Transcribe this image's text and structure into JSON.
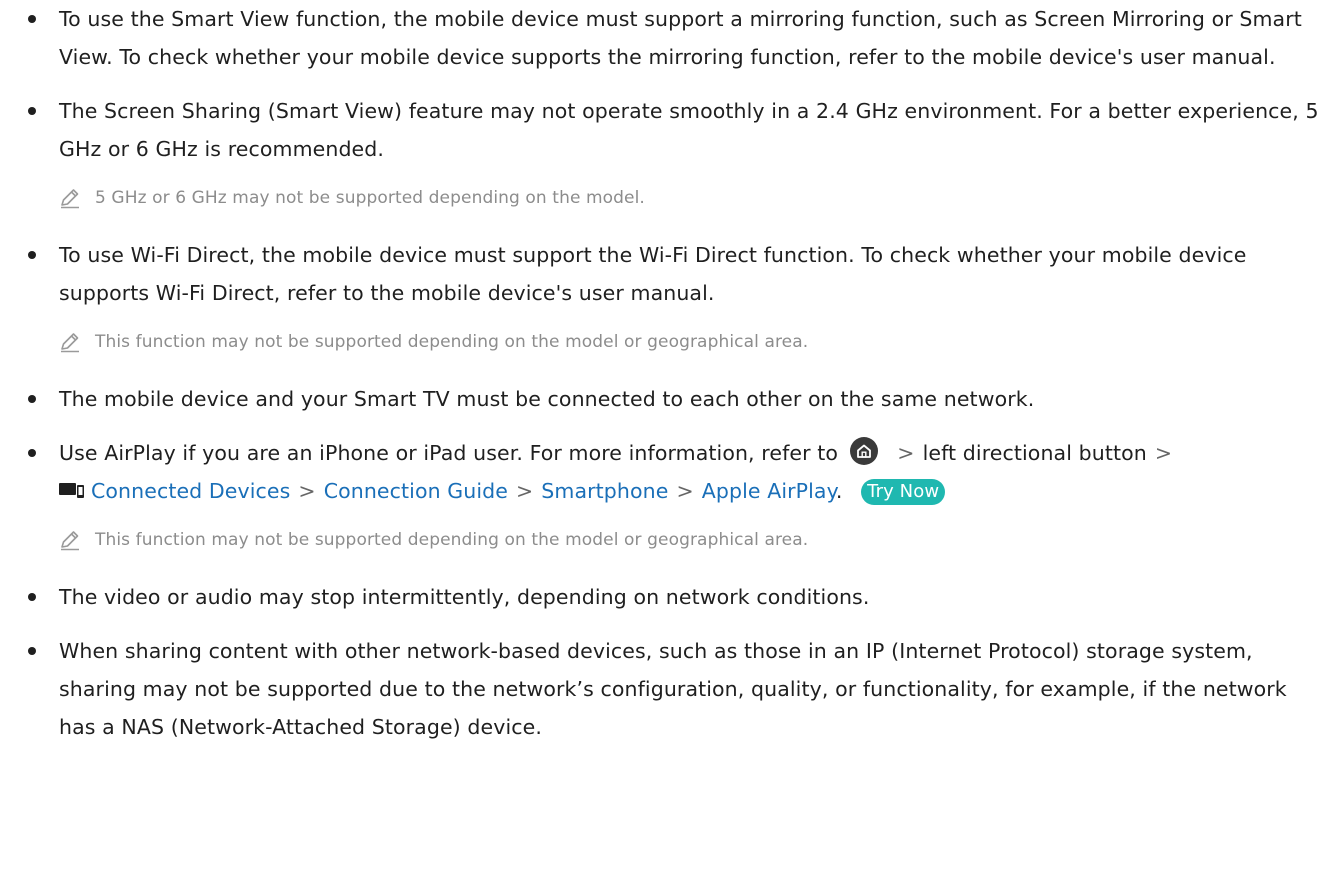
{
  "items": [
    {
      "text": "To use the Smart View function, the mobile device must support a mirroring function, such as Screen Mirroring or Smart View. To check whether your mobile device supports the mirroring function, refer to the mobile device's user manual."
    },
    {
      "text": "The Screen Sharing (Smart View) feature may not operate smoothly in a 2.4 GHz environment. For a better experience, 5 GHz or 6 GHz is recommended.",
      "note": "5 GHz or 6 GHz may not be supported depending on the model."
    },
    {
      "text": "To use Wi-Fi Direct, the mobile device must support the Wi-Fi Direct function. To check whether your mobile device supports Wi-Fi Direct, refer to the mobile device's user manual.",
      "note": "This function may not be supported depending on the model or geographical area."
    },
    {
      "text": "The mobile device and your Smart TV must be connected to each other on the same network."
    },
    {
      "text_before": "Use AirPlay if you are an iPhone or iPad user. For more information, refer to",
      "sep": ">",
      "text_after_home": "left directional button",
      "path": [
        "Connected Devices",
        "Connection Guide",
        "Smartphone",
        "Apple AirPlay"
      ],
      "path_end": ".",
      "try_now": "Try Now",
      "note": "This function may not be supported depending on the model or geographical area."
    },
    {
      "text": "The video or audio may stop intermittently, depending on network conditions."
    },
    {
      "text": "When sharing content with other network-based devices, such as those in an IP (Internet Protocol) storage system, sharing may not be supported due to the network’s configuration, quality, or functionality, for example, if the network has a NAS (Network-Attached Storage) device."
    }
  ],
  "colors": {
    "text": "#1f1f1f",
    "note": "#8c8c8c",
    "link": "#1a6fb8",
    "try_now_bg": "#1fb8b0"
  },
  "icons": {
    "note": "pencil-icon",
    "home": "home-icon",
    "connected_devices": "connected-devices-icon"
  }
}
